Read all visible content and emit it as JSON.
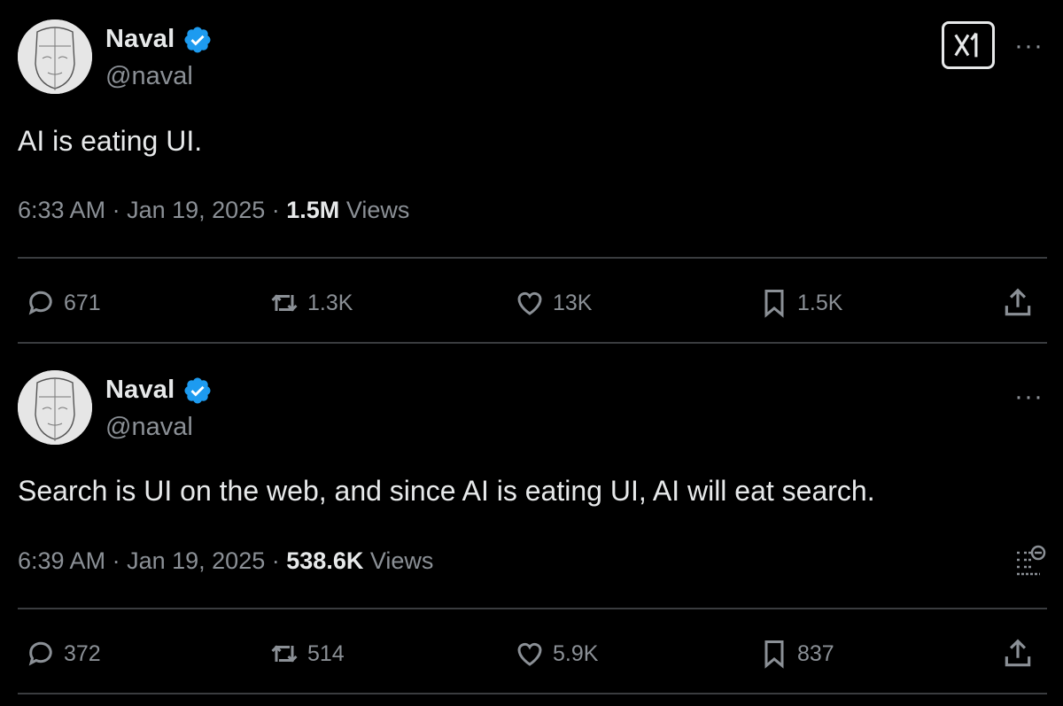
{
  "tweets": [
    {
      "author": "Naval",
      "handle": "@naval",
      "text": "AI is eating UI.",
      "time": "6:33 AM",
      "date": "Jan 19, 2025",
      "views_count": "1.5M",
      "views_label": "Views",
      "replies": "671",
      "reposts": "1.3K",
      "likes": "13K",
      "bookmarks": "1.5K"
    },
    {
      "author": "Naval",
      "handle": "@naval",
      "text": "Search is UI on the web, and since AI is eating UI, AI will eat search.",
      "time": "6:39 AM",
      "date": "Jan 19, 2025",
      "views_count": "538.6K",
      "views_label": "Views",
      "replies": "372",
      "reposts": "514",
      "likes": "5.9K",
      "bookmarks": "837"
    }
  ],
  "more_glyph": "···",
  "separator": "·",
  "colors": {
    "background": "#000000",
    "text": "#e7e9ea",
    "muted": "#8b9096",
    "verified": "#1d9bf0"
  },
  "icons": [
    "verified-badge-icon",
    "grok-icon",
    "more-icon",
    "reply-icon",
    "repost-icon",
    "like-icon",
    "bookmark-icon",
    "share-icon",
    "analyze-post-icon"
  ]
}
